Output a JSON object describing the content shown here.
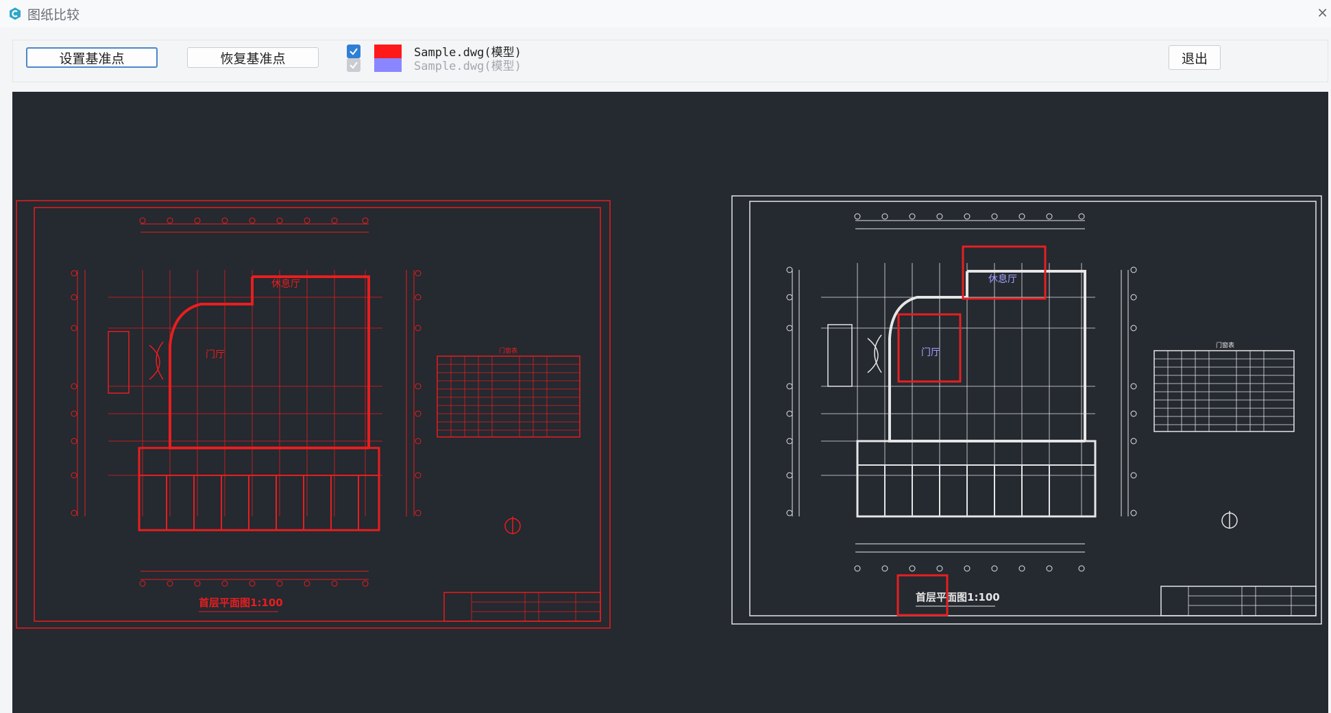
{
  "window": {
    "title": "图纸比较",
    "icon": "app-logo-icon",
    "close_glyph": "×"
  },
  "toolbar": {
    "set_base_point_label": "设置基准点",
    "restore_base_point_label": "恢复基准点",
    "exit_label": "退出",
    "layers": [
      {
        "label": "Sample.dwg(模型)",
        "checked": true,
        "color": "#ff1a1a",
        "enabled": true
      },
      {
        "label": "Sample.dwg(模型)",
        "checked": true,
        "color": "#8a86ff",
        "enabled": false
      }
    ]
  },
  "drawings": {
    "left": {
      "stroke_color": "#e81e1e",
      "rooms": [
        "休息厅",
        "门厅"
      ],
      "plan_title": "首层平面图1:100",
      "door_table_title": "门窗表"
    },
    "right": {
      "stroke_color": "#e6e6e6",
      "highlight_color": "#e62020",
      "diff_text_color": "#a6a4ff",
      "rooms": [
        "休息厅",
        "门厅"
      ],
      "plan_title": "首层平面图1:100",
      "door_table_title": "门窗表"
    }
  },
  "colors": {
    "canvas_bg": "#252930",
    "accent": "#2f7fd6"
  }
}
